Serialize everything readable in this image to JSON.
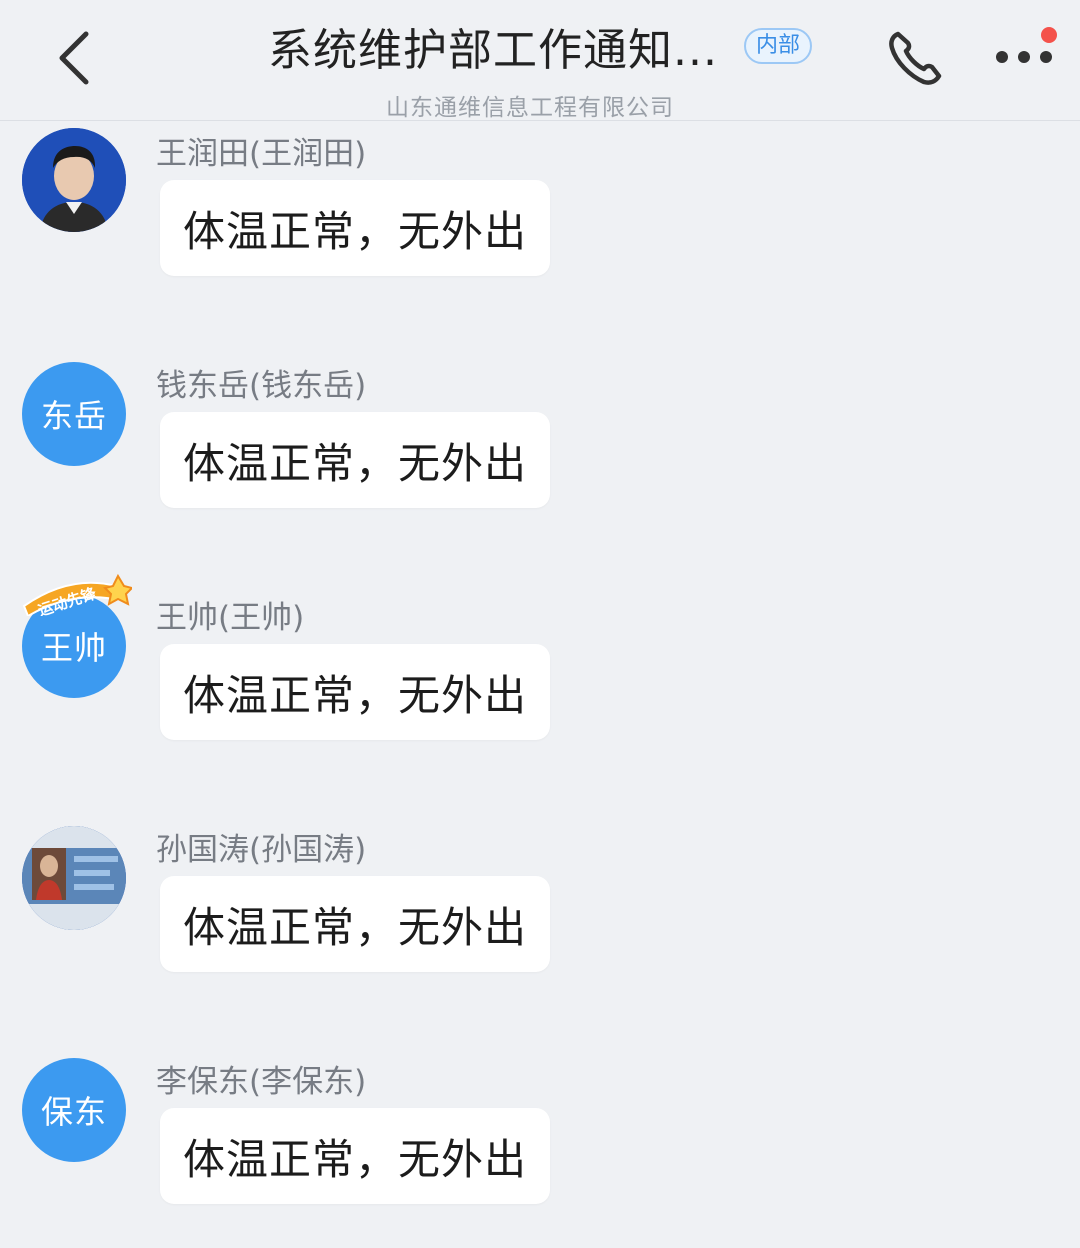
{
  "header": {
    "title": "系统维护部工作通知...",
    "badge": "内部",
    "subtitle": "山东通维信息工程有限公司"
  },
  "messages": [
    {
      "sender": "王润田(王润田)",
      "avatar_text": "",
      "avatar_type": "photo",
      "text": "体温正常，无外出"
    },
    {
      "sender": "钱东岳(钱东岳)",
      "avatar_text": "东岳",
      "avatar_type": "text",
      "text": "体温正常，无外出"
    },
    {
      "sender": "王帅(王帅)",
      "avatar_text": "王帅",
      "avatar_type": "text",
      "text": "体温正常，无外出",
      "avatar_badge": "运动先锋"
    },
    {
      "sender": "孙国涛(孙国涛)",
      "avatar_text": "",
      "avatar_type": "photo",
      "text": "体温正常，无外出"
    },
    {
      "sender": "李保东(李保东)",
      "avatar_text": "保东",
      "avatar_type": "text",
      "text": "体温正常，无外出"
    }
  ],
  "colors": {
    "accent": "#3c9af0",
    "background": "#eff1f4",
    "notification_dot": "#f4524b"
  },
  "icons": [
    "chevron-left-icon",
    "phone-icon",
    "more-dots-icon"
  ]
}
